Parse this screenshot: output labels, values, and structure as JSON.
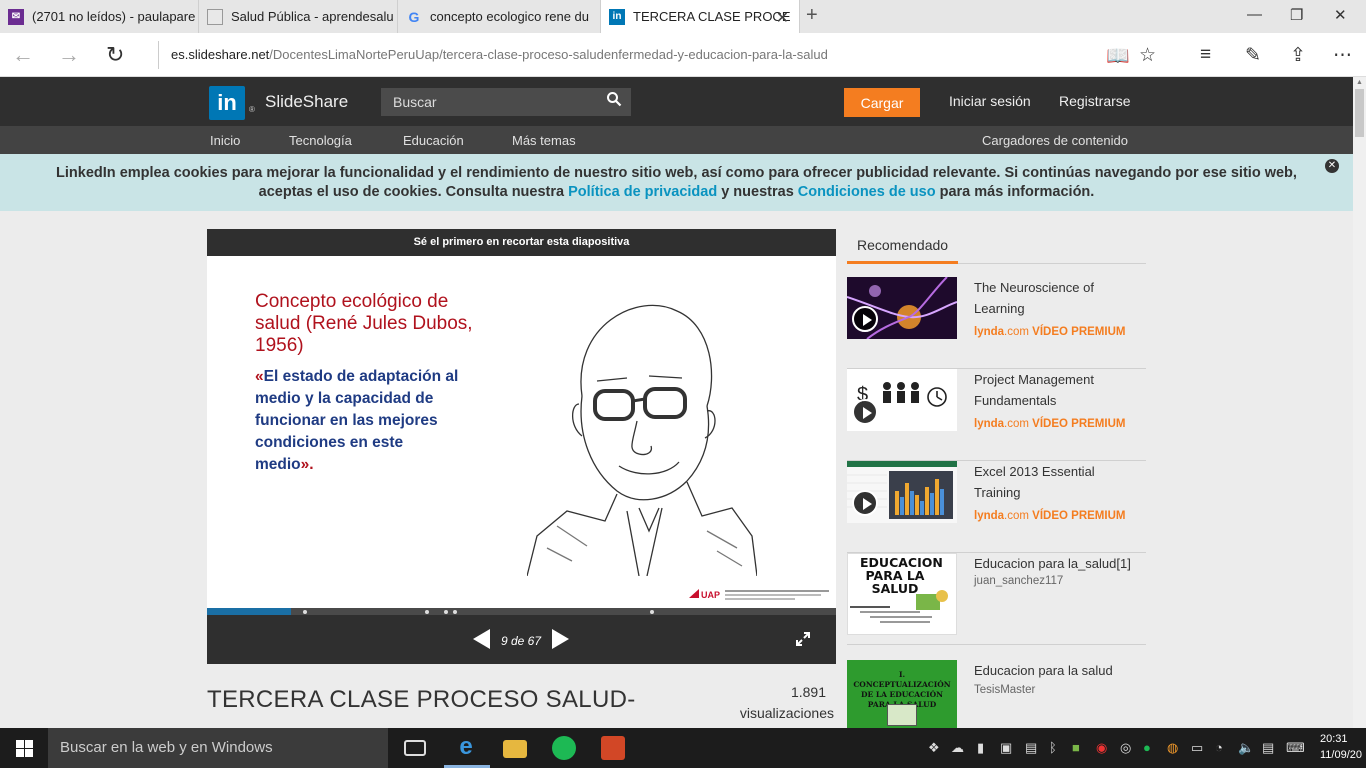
{
  "browser": {
    "tabs": [
      {
        "label": "(2701 no leídos) - paulapare",
        "icon": "mail-icon"
      },
      {
        "label": "Salud Pública - aprendesalu",
        "icon": "page-icon"
      },
      {
        "label": "concepto ecologico rene du",
        "icon": "google-icon"
      },
      {
        "label": "TERCERA CLASE PROCE",
        "icon": "linkedin-icon"
      }
    ],
    "url_host": "es.slideshare.net",
    "url_path": "/DocentesLimaNortePeruUap/tercera-clase-proceso-saludenfermedad-y-educacion-para-la-salud"
  },
  "header": {
    "logo_mark": "in",
    "logo_text": "SlideShare",
    "search_placeholder": "Buscar",
    "upload_label": "Cargar",
    "login_label": "Iniciar sesión",
    "register_label": "Registrarse"
  },
  "nav": {
    "items": [
      "Inicio",
      "Tecnología",
      "Educación",
      "Más temas"
    ],
    "right_item": "Cargadores de contenido"
  },
  "cookie": {
    "text_1": "LinkedIn emplea cookies para mejorar la funcionalidad y el rendimiento de nuestro sitio web, así como para ofrecer publicidad relevante. Si continúas navegando por ese sitio web,",
    "text_2": "aceptas el uso de cookies. Consulta nuestra",
    "link_privacy": "Política de privacidad",
    "text_3": "y nuestras",
    "link_terms": "Condiciones de uso",
    "text_4": "para más información."
  },
  "player": {
    "clip_banner": "Sé el primero en recortar esta diapositiva",
    "slide_title": "Concepto ecológico de salud (René Jules Dubos, 1956)",
    "slide_quote_open": "«",
    "slide_body": "El estado de adaptación al medio y la capacidad de funcionar en las mejores condiciones en este medio",
    "slide_quote_close": "».",
    "page_indicator": "9 de 67",
    "progress_fraction": 0.134
  },
  "document": {
    "title": "TERCERA CLASE PROCESO SALUD-",
    "views_count": "1.891",
    "views_label": "visualizaciones"
  },
  "recommended": {
    "heading": "Recomendado",
    "items": [
      {
        "title": "The Neuroscience of Learning",
        "brand": "lynda",
        "domain": ".com",
        "tag": "VÍDEO PREMIUM"
      },
      {
        "title": "Project Management Fundamentals",
        "brand": "lynda",
        "domain": ".com",
        "tag": "VÍDEO PREMIUM"
      },
      {
        "title": "Excel 2013 Essential Training",
        "brand": "lynda",
        "domain": ".com",
        "tag": "VÍDEO PREMIUM"
      },
      {
        "title": "Educacion para la_salud[1]",
        "author": "juan_sanchez117",
        "thumb_text": "EDUCACION PARA LA SALUD"
      },
      {
        "title": "Educacion para la salud",
        "author": "TesisMaster",
        "thumb_text": "I. CONCEPTUALIZACIÓN DE LA EDUCACIÓN PARA LA SALUD"
      }
    ]
  },
  "taskbar": {
    "search_placeholder": "Buscar en la web y en Windows",
    "time": "20:31",
    "date": "11/09/20"
  },
  "colors": {
    "accent_orange": "#f47d20",
    "linkedin_blue": "#0077b5",
    "slide_red": "#b0121d",
    "slide_blue": "#1f3b83"
  }
}
